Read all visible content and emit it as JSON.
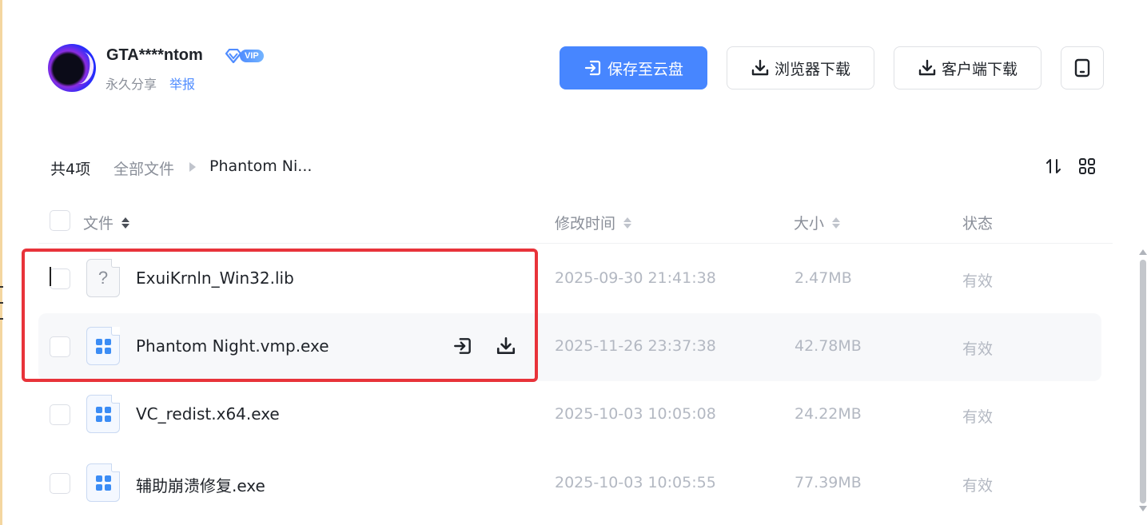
{
  "header": {
    "user_name": "GTA****ntom",
    "vip_label": "VIP",
    "share_type": "永久分享",
    "report_link": "举报"
  },
  "actions": {
    "save_label": "保存至云盘",
    "browser_download_label": "浏览器下载",
    "client_download_label": "客户端下载"
  },
  "toolbar": {
    "count": "共4项",
    "breadcrumb_root": "全部文件",
    "breadcrumb_current": "Phantom Ni..."
  },
  "table": {
    "headers": {
      "name": "文件",
      "modified": "修改时间",
      "size": "大小",
      "status": "状态"
    },
    "rows": [
      {
        "icon": "unknown-file-icon",
        "name": "ExuiKrnln_Win32.lib",
        "modified": "2025-09-30 21:41:38",
        "size": "2.47MB",
        "status": "有效"
      },
      {
        "icon": "exe-file-icon",
        "name": "Phantom Night.vmp.exe",
        "modified": "2025-11-26 23:37:38",
        "size": "42.78MB",
        "status": "有效"
      },
      {
        "icon": "exe-file-icon",
        "name": "VC_redist.x64.exe",
        "modified": "2025-10-03 10:05:08",
        "size": "24.22MB",
        "status": "有效"
      },
      {
        "icon": "exe-file-icon",
        "name": "辅助崩溃修复.exe",
        "modified": "2025-10-03 10:05:55",
        "size": "77.39MB",
        "status": "有效"
      }
    ]
  },
  "colors": {
    "primary": "#4786ff",
    "highlight": "#e8333a",
    "muted_text": "#b3b8c2"
  }
}
